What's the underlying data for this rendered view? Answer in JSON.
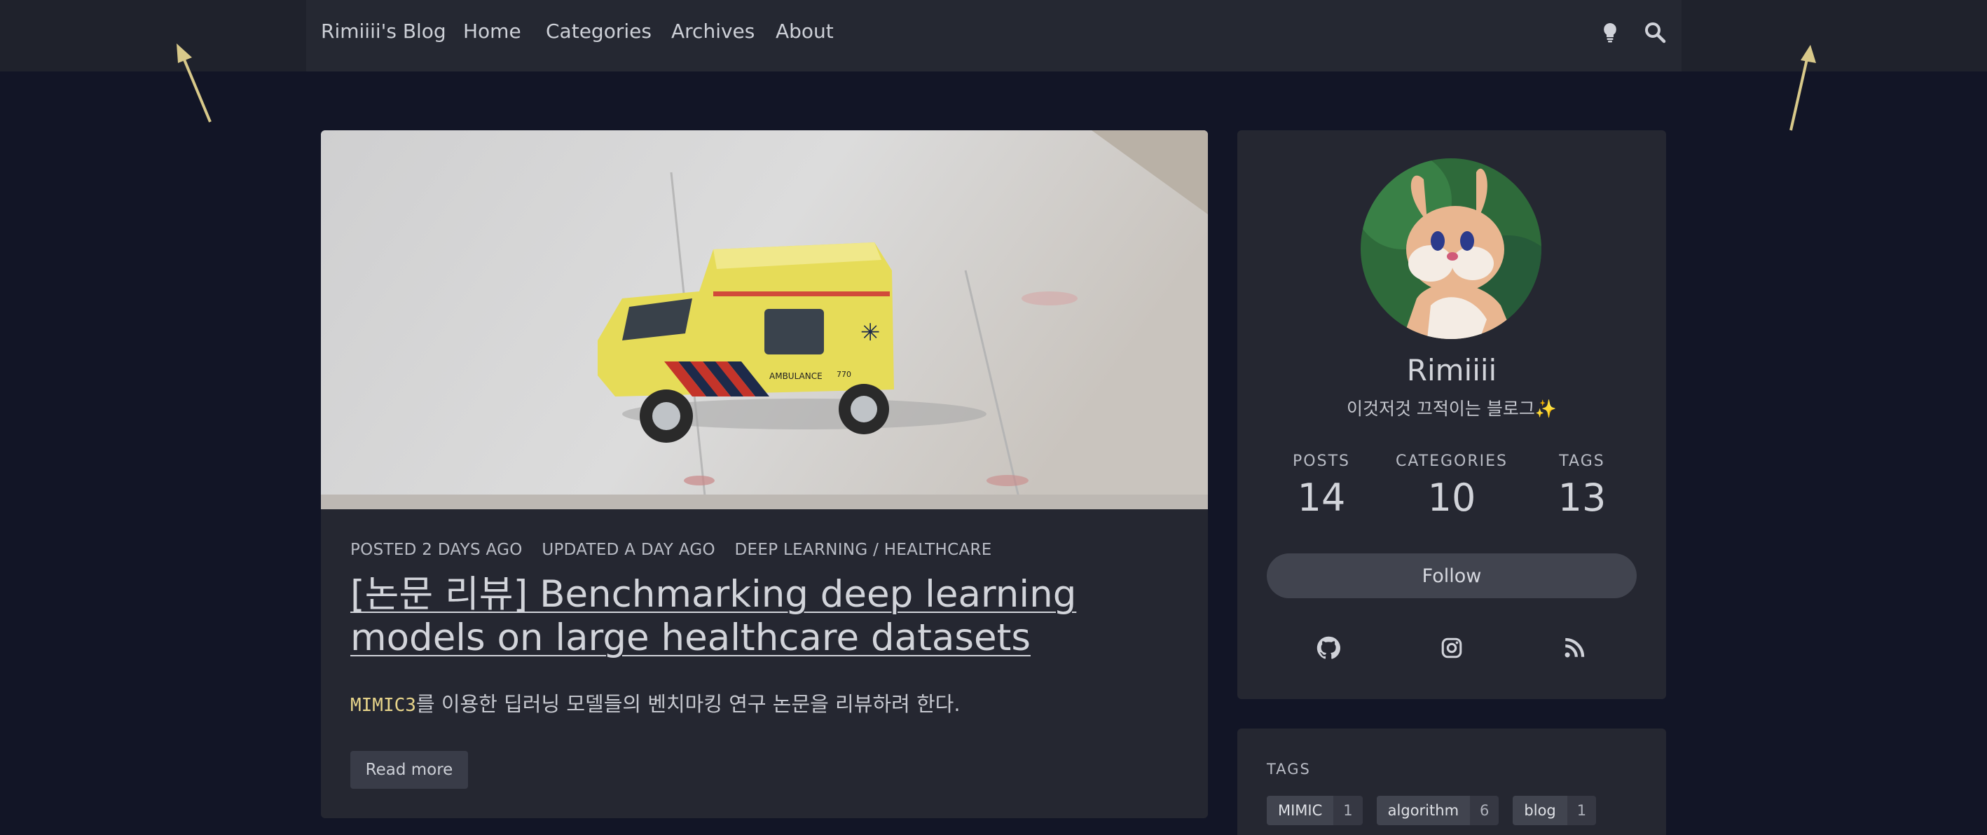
{
  "nav": {
    "brand": "Rimiiii's Blog",
    "links": [
      "Home",
      "Categories",
      "Archives",
      "About"
    ],
    "icons": [
      "lightbulb-icon",
      "search-icon"
    ]
  },
  "post": {
    "meta": {
      "posted": "POSTED 2 DAYS AGO",
      "updated": "UPDATED A DAY AGO",
      "category": "DEEP LEARNING / HEALTHCARE"
    },
    "title": "[논문 리뷰] Benchmarking deep learning models on large healthcare datasets",
    "excerpt_code": "MIMIC3",
    "excerpt_text": "를 이용한 딥러닝 모델들의 벤치마킹 연구 논문을 리뷰하려 한다.",
    "read_more": "Read more"
  },
  "profile": {
    "name": "Rimiiii",
    "bio": "이것저것 끄적이는 블로그✨",
    "stats": [
      {
        "label": "POSTS",
        "value": "14"
      },
      {
        "label": "CATEGORIES",
        "value": "10"
      },
      {
        "label": "TAGS",
        "value": "13"
      }
    ],
    "follow": "Follow",
    "social_icons": [
      "github-icon",
      "instagram-icon",
      "rss-icon"
    ]
  },
  "tags": {
    "title": "TAGS",
    "items": [
      {
        "name": "MIMIC",
        "count": "1"
      },
      {
        "name": "algorithm",
        "count": "6"
      },
      {
        "name": "blog",
        "count": "1"
      }
    ]
  },
  "colors": {
    "page_bg": "#121526",
    "card_bg": "#252731",
    "accent_code": "#e7d48a",
    "annotation_arrow": "#d8c98a"
  }
}
